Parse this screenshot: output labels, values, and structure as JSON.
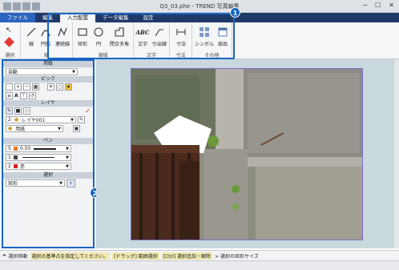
{
  "window": {
    "title": "Q3_03.phe - TREND 写真編集",
    "min_icon": "minimize-icon",
    "max_icon": "maximize-icon",
    "close_icon": "close-icon"
  },
  "menu": {
    "tabs": [
      {
        "label": "ファイル"
      },
      {
        "label": "編集"
      },
      {
        "label": "入力配置"
      },
      {
        "label": "データ編集"
      },
      {
        "label": "設定"
      }
    ]
  },
  "ribbon": {
    "groups": {
      "select": {
        "label": "選択"
      },
      "line": {
        "label": "線",
        "buttons": [
          "線",
          "円弧",
          "連続線"
        ]
      },
      "region": {
        "label": "領域",
        "buttons": [
          "矩形",
          "円",
          "閉合多角"
        ]
      },
      "text": {
        "label": "文字",
        "buttons": [
          "文字",
          "引出線"
        ],
        "abc": "ABC"
      },
      "dim": {
        "label": "寸法",
        "buttons": [
          "寸法"
        ]
      },
      "other": {
        "label": "その他",
        "buttons": [
          "シンボル",
          "部品"
        ]
      }
    }
  },
  "callouts": {
    "one": "1",
    "two": "2"
  },
  "panel": {
    "paper": {
      "header": "用紙",
      "value": "自動"
    },
    "pick": {
      "header": "ピック",
      "a_label": "A"
    },
    "layer": {
      "header": "レイヤ",
      "number": "2",
      "name": "レイヤ001",
      "sub": "用紙"
    },
    "pen": {
      "header": "ペン",
      "rows": [
        {
          "num": "5",
          "label": "0.50",
          "color": "#e07a1a"
        },
        {
          "num": "1",
          "label": "",
          "color": "#444444"
        },
        {
          "num": "2",
          "label": "赤",
          "color": "#d02020"
        }
      ]
    },
    "select": {
      "header": "選択",
      "value": "矩形"
    }
  },
  "status": {
    "mode": "選択移動",
    "hint1": "選択の基準点を指定してください。",
    "hint2": "[ドラッグ] 範囲選択",
    "hint3": "[Ctrl] 選択追加・解除",
    "hint4": "> 選択の矩形サイズ"
  },
  "colors": {
    "accent": "#1565c0",
    "menubar": "#1f3a68"
  }
}
